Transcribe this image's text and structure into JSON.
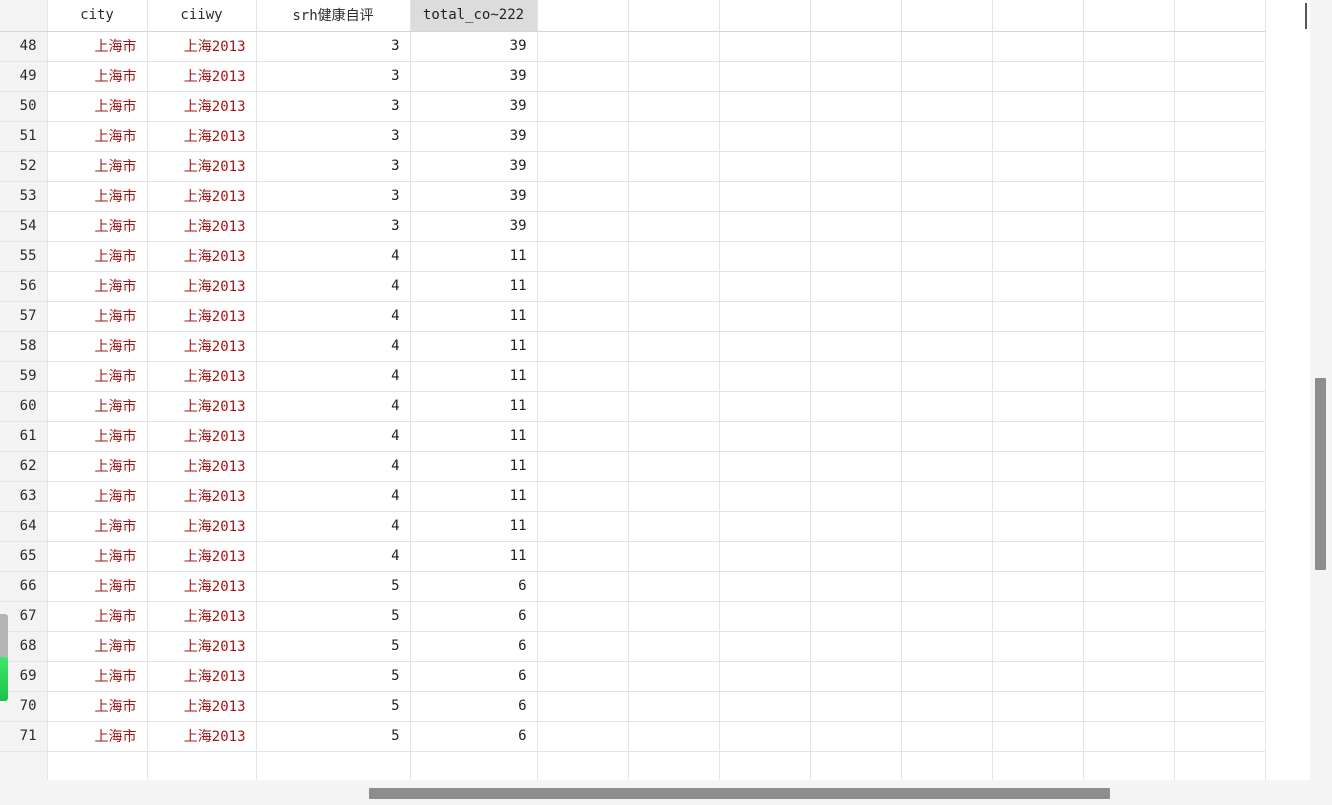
{
  "columns": [
    {
      "label": "",
      "kind": "corner"
    },
    {
      "label": "city",
      "kind": "str"
    },
    {
      "label": "ciiwy",
      "kind": "str"
    },
    {
      "label": "srh健康自评",
      "kind": "num"
    },
    {
      "label": "total_co~222",
      "kind": "num",
      "selected": true
    },
    {
      "label": "",
      "kind": "empty"
    },
    {
      "label": "",
      "kind": "empty"
    },
    {
      "label": "",
      "kind": "empty"
    },
    {
      "label": "",
      "kind": "empty"
    },
    {
      "label": "",
      "kind": "empty"
    },
    {
      "label": "",
      "kind": "empty"
    },
    {
      "label": "",
      "kind": "empty"
    },
    {
      "label": "",
      "kind": "empty"
    }
  ],
  "rows": [
    {
      "n": "48",
      "city": "上海市",
      "ciiwy": "上海2013",
      "srh": "3",
      "total": "39"
    },
    {
      "n": "49",
      "city": "上海市",
      "ciiwy": "上海2013",
      "srh": "3",
      "total": "39"
    },
    {
      "n": "50",
      "city": "上海市",
      "ciiwy": "上海2013",
      "srh": "3",
      "total": "39"
    },
    {
      "n": "51",
      "city": "上海市",
      "ciiwy": "上海2013",
      "srh": "3",
      "total": "39"
    },
    {
      "n": "52",
      "city": "上海市",
      "ciiwy": "上海2013",
      "srh": "3",
      "total": "39"
    },
    {
      "n": "53",
      "city": "上海市",
      "ciiwy": "上海2013",
      "srh": "3",
      "total": "39"
    },
    {
      "n": "54",
      "city": "上海市",
      "ciiwy": "上海2013",
      "srh": "3",
      "total": "39"
    },
    {
      "n": "55",
      "city": "上海市",
      "ciiwy": "上海2013",
      "srh": "4",
      "total": "11"
    },
    {
      "n": "56",
      "city": "上海市",
      "ciiwy": "上海2013",
      "srh": "4",
      "total": "11"
    },
    {
      "n": "57",
      "city": "上海市",
      "ciiwy": "上海2013",
      "srh": "4",
      "total": "11"
    },
    {
      "n": "58",
      "city": "上海市",
      "ciiwy": "上海2013",
      "srh": "4",
      "total": "11"
    },
    {
      "n": "59",
      "city": "上海市",
      "ciiwy": "上海2013",
      "srh": "4",
      "total": "11"
    },
    {
      "n": "60",
      "city": "上海市",
      "ciiwy": "上海2013",
      "srh": "4",
      "total": "11"
    },
    {
      "n": "61",
      "city": "上海市",
      "ciiwy": "上海2013",
      "srh": "4",
      "total": "11"
    },
    {
      "n": "62",
      "city": "上海市",
      "ciiwy": "上海2013",
      "srh": "4",
      "total": "11"
    },
    {
      "n": "63",
      "city": "上海市",
      "ciiwy": "上海2013",
      "srh": "4",
      "total": "11"
    },
    {
      "n": "64",
      "city": "上海市",
      "ciiwy": "上海2013",
      "srh": "4",
      "total": "11"
    },
    {
      "n": "65",
      "city": "上海市",
      "ciiwy": "上海2013",
      "srh": "4",
      "total": "11"
    },
    {
      "n": "66",
      "city": "上海市",
      "ciiwy": "上海2013",
      "srh": "5",
      "total": "6"
    },
    {
      "n": "67",
      "city": "上海市",
      "ciiwy": "上海2013",
      "srh": "5",
      "total": "6"
    },
    {
      "n": "68",
      "city": "上海市",
      "ciiwy": "上海2013",
      "srh": "5",
      "total": "6"
    },
    {
      "n": "69",
      "city": "上海市",
      "ciiwy": "上海2013",
      "srh": "5",
      "total": "6"
    },
    {
      "n": "70",
      "city": "上海市",
      "ciiwy": "上海2013",
      "srh": "5",
      "total": "6"
    },
    {
      "n": "71",
      "city": "上海市",
      "ciiwy": "上海2013",
      "srh": "5",
      "total": "6"
    },
    {
      "n": "",
      "city": "",
      "ciiwy": "",
      "srh": "",
      "total": ""
    }
  ],
  "colors": {
    "string_value": "#a31515",
    "numeric_value": "#1f1f1f",
    "selected_header": "#dcdcdc",
    "row_header": "#f3f3f3",
    "gridline": "#e4e4e4",
    "scrollbar_thumb": "#8d8d8d",
    "indicator_green": "#2ed85a"
  }
}
